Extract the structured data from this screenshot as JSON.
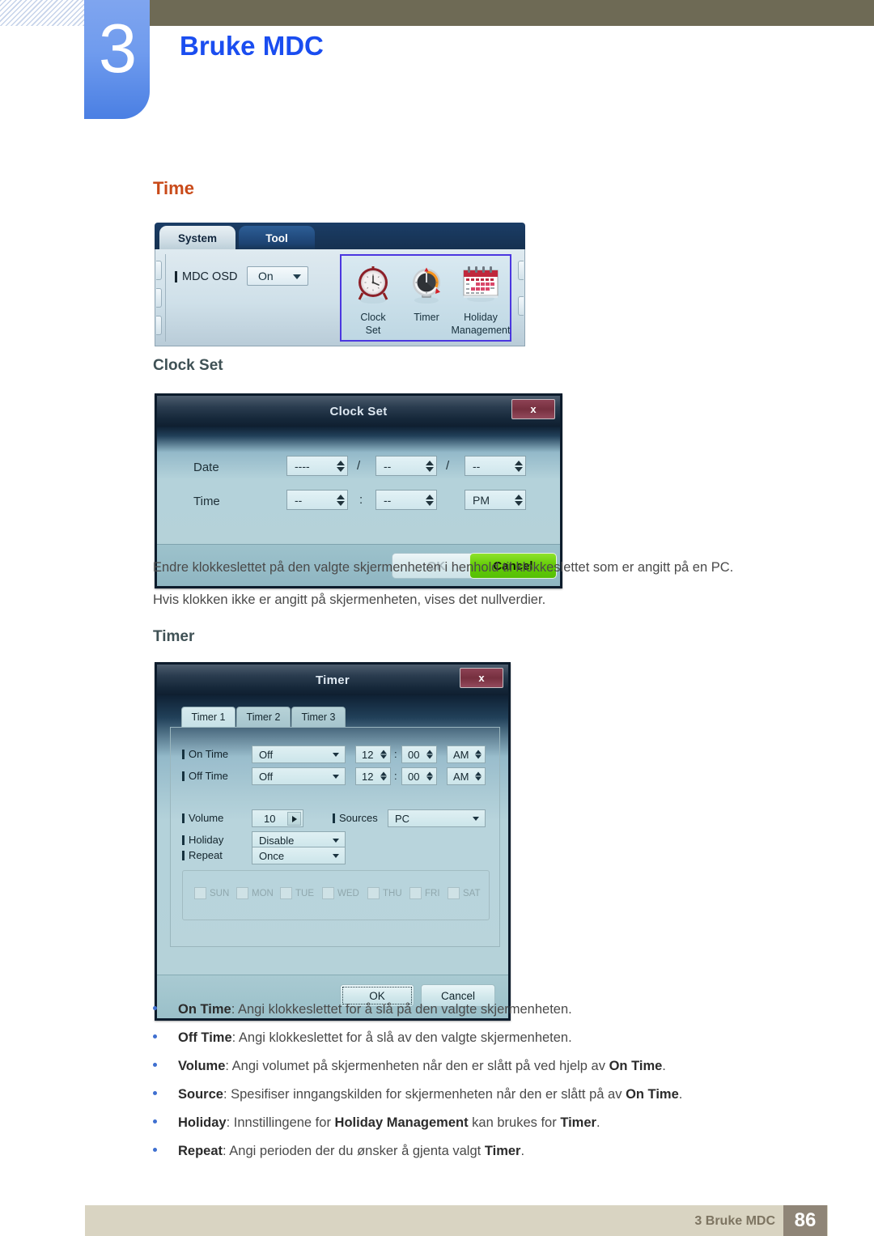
{
  "header": {
    "chapter_number": "3",
    "chapter_title": "Bruke MDC"
  },
  "headings": {
    "time": "Time",
    "clock_set": "Clock Set",
    "timer": "Timer"
  },
  "paragraphs": {
    "p1": "Endre klokkeslettet på den valgte skjermenheten i henhold til klokkeslettet som er angitt på en PC.",
    "p2": "Hvis klokken ikke er angitt på skjermenheten, vises det nullverdier."
  },
  "time_panel": {
    "tabs": [
      {
        "label": "System",
        "active": true
      },
      {
        "label": "Tool",
        "active": false
      }
    ],
    "mdc_osd_label": "MDC OSD",
    "mdc_osd_value": "On",
    "icons": [
      {
        "name": "clock-set-icon",
        "caption_line1": "Clock",
        "caption_line2": "Set"
      },
      {
        "name": "timer-icon",
        "caption_line1": "Timer",
        "caption_line2": ""
      },
      {
        "name": "holiday-management-icon",
        "caption_line1": "Holiday",
        "caption_line2": "Management"
      }
    ],
    "highlight_color": "#4b37e0"
  },
  "clock_set_dialog": {
    "title": "Clock Set",
    "close_label": "x",
    "date_label": "Date",
    "time_label": "Time",
    "date_year": "----",
    "date_month": "--",
    "date_day": "--",
    "time_hour": "--",
    "time_minute": "--",
    "time_meridiem": "PM",
    "separator_slash": "/",
    "separator_colon": ":",
    "ok_label": "OK",
    "cancel_label": "Cancel",
    "cancel_color": "#63cc08"
  },
  "timer_dialog": {
    "title": "Timer",
    "close_label": "x",
    "tabs": [
      {
        "label": "Timer 1",
        "active": true
      },
      {
        "label": "Timer 2",
        "active": false
      },
      {
        "label": "Timer 3",
        "active": false
      }
    ],
    "on_time": {
      "label": "On Time",
      "mode": "Off",
      "hour": "12",
      "minute": "00",
      "meridiem": "AM"
    },
    "off_time": {
      "label": "Off Time",
      "mode": "Off",
      "hour": "12",
      "minute": "00",
      "meridiem": "AM"
    },
    "volume": {
      "label": "Volume",
      "value": "10"
    },
    "sources": {
      "label": "Sources",
      "value": "PC"
    },
    "holiday": {
      "label": "Holiday",
      "value": "Disable"
    },
    "repeat": {
      "label": "Repeat",
      "value": "Once"
    },
    "days": [
      "SUN",
      "MON",
      "TUE",
      "WED",
      "THU",
      "FRI",
      "SAT"
    ],
    "colon": ":",
    "ok_label": "OK",
    "cancel_label": "Cancel"
  },
  "bullets": [
    {
      "term": "On Time",
      "rest": ": Angi klokkeslettet for å slå på den valgte skjermenheten."
    },
    {
      "term": "Off Time",
      "rest": ": Angi klokkeslettet for å slå av den valgte skjermenheten."
    },
    {
      "term": "Volume",
      "rest": ": Angi volumet på skjermenheten når den er slått på ved hjelp av ",
      "term2": "On Time",
      "tail": "."
    },
    {
      "term": "Source",
      "rest": ": Spesifiser inngangskilden for skjermenheten når den er slått på av ",
      "term2": "On Time",
      "tail": "."
    },
    {
      "term": "Holiday",
      "rest": ": Innstillingene for ",
      "term2": "Holiday Management",
      "mid": " kan brukes for ",
      "term3": "Timer",
      "tail": "."
    },
    {
      "term": "Repeat",
      "rest": ": Angi perioden der du ønsker å gjenta valgt ",
      "term2": "Timer",
      "tail": "."
    }
  ],
  "footer": {
    "text": "3 Bruke MDC",
    "page": "86"
  }
}
